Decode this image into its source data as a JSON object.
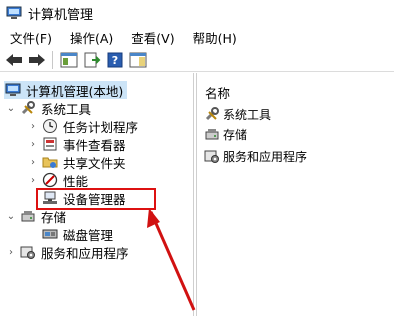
{
  "window": {
    "title": "计算机管理",
    "app_icon": "computer-management-icon"
  },
  "menubar": {
    "items": [
      "文件(F)",
      "操作(A)",
      "查看(V)",
      "帮助(H)"
    ]
  },
  "toolbar": {
    "buttons": [
      "back-arrow-icon",
      "forward-arrow-icon",
      "show-hide-console-tree-icon",
      "export-list-icon",
      "help-icon",
      "show-action-pane-icon"
    ]
  },
  "tree": {
    "root": "计算机管理(本地)",
    "system_tools": "系统工具",
    "task_scheduler": "任务计划程序",
    "event_viewer": "事件查看器",
    "shared_folders": "共享文件夹",
    "performance": "性能",
    "device_manager": "设备管理器",
    "storage": "存储",
    "disk_management": "磁盘管理",
    "services_apps": "服务和应用程序"
  },
  "content": {
    "column_header": "名称",
    "items": [
      "系统工具",
      "存储",
      "服务和应用程序"
    ]
  },
  "colors": {
    "selection": "#cce4f7",
    "annotation_red": "#d11111"
  }
}
